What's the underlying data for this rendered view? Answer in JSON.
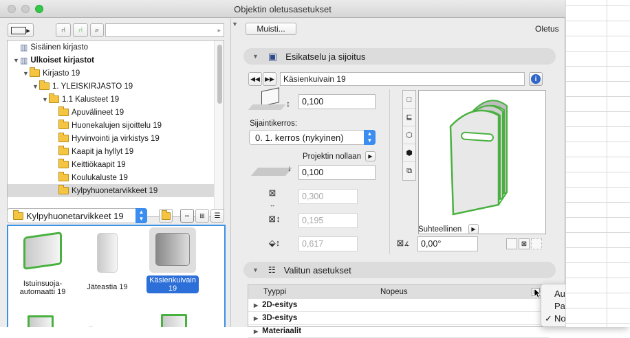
{
  "window": {
    "title": "Objektin oletusasetukset"
  },
  "left": {
    "search_placeholder": "",
    "tree": [
      {
        "label": "Sisäinen kirjasto",
        "level": 0,
        "bold": false,
        "icon": "library-icon"
      },
      {
        "label": "Ulkoiset kirjastot",
        "level": 0,
        "bold": true,
        "icon": "library-icon",
        "expanded": true
      },
      {
        "label": "Kirjasto 19",
        "level": 1,
        "bold": false,
        "icon": "folder-icon",
        "expanded": true
      },
      {
        "label": "1. YLEISKIRJASTO 19",
        "level": 2,
        "bold": false,
        "icon": "folder-icon",
        "expanded": true
      },
      {
        "label": "1.1 Kalusteet 19",
        "level": 3,
        "bold": false,
        "icon": "folder-icon",
        "expanded": true
      },
      {
        "label": "Apuvälineet 19",
        "level": 4,
        "bold": false,
        "icon": "folder-icon"
      },
      {
        "label": "Huonekalujen sijoittelu 19",
        "level": 4,
        "bold": false,
        "icon": "folder-icon"
      },
      {
        "label": "Hyvinvointi ja virkistys 19",
        "level": 4,
        "bold": false,
        "icon": "folder-icon"
      },
      {
        "label": "Kaapit ja hyllyt 19",
        "level": 4,
        "bold": false,
        "icon": "folder-icon"
      },
      {
        "label": "Keittiökaapit 19",
        "level": 4,
        "bold": false,
        "icon": "folder-icon"
      },
      {
        "label": "Koulukaluste 19",
        "level": 4,
        "bold": false,
        "icon": "folder-icon"
      },
      {
        "label": "Kylpyhuonetarvikkeet 19",
        "level": 4,
        "bold": false,
        "icon": "folder-icon",
        "selected": true
      }
    ],
    "folder_popup": "Kylpyhuonetarvikkeet 19",
    "thumbs": [
      {
        "label": "Istuinsuoja-automaatti 19",
        "selected": false
      },
      {
        "label": "Jäteastia 19",
        "selected": false
      },
      {
        "label": "Käsienkuivain 19",
        "selected": true
      }
    ]
  },
  "right": {
    "memory_button": "Muisti...",
    "default_label": "Oletus",
    "section_preview": "Esikatselu ja sijoitus",
    "object_name": "Käsienkuivain 19",
    "elevation": "0,100",
    "story_label": "Sijaintikerros:",
    "story_value": "0. 1. kerros (nykyinen)",
    "project_zero_label": "Projektin nollaan",
    "project_zero_value": "0,100",
    "width": "0,300",
    "depth": "0,195",
    "height": "0,617",
    "relative_label": "Suhteellinen",
    "angle": "0,00°",
    "section_settings": "Valitun asetukset",
    "table_header_type": "Tyyppi",
    "table_header_value": "Nopeus",
    "rows": [
      "2D-esitys",
      "3D-esitys",
      "Materiaalit"
    ]
  },
  "menu": {
    "items": [
      "Automaattinen",
      "Painonappi",
      "Nopeus"
    ],
    "checked_index": 2
  },
  "colors": {
    "accent": "#3b8df0",
    "object_outline": "#49b13f",
    "folder": "#f5c542"
  }
}
